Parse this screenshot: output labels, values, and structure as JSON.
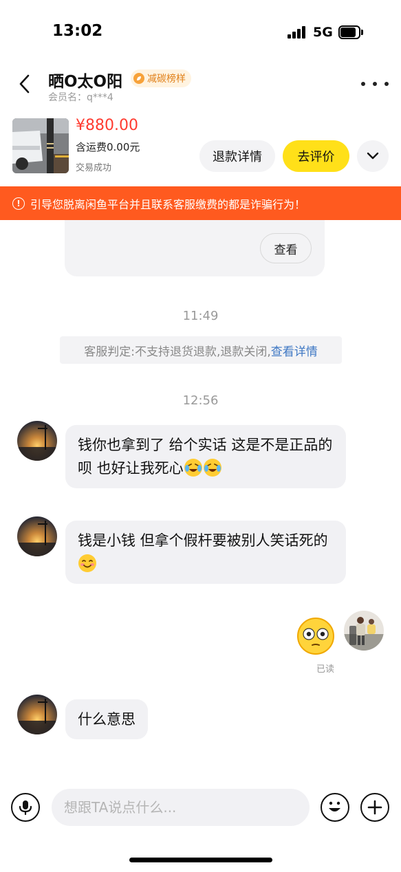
{
  "status_bar": {
    "time": "13:02",
    "network": "5G",
    "icons": [
      "signal-icon",
      "battery-icon"
    ]
  },
  "header": {
    "contact_name": "晒O太O阳",
    "badge_label": "减碳榜样",
    "member_label": "会员名：",
    "member_id": "q***4",
    "icons": [
      "back-arrow-icon",
      "more-dots-icon"
    ]
  },
  "product": {
    "price": "¥880.00",
    "shipping": "含运费0.00元",
    "status": "交易成功",
    "refund_label": "退款详情",
    "review_label": "去评价",
    "icons": [
      "chevron-down-icon"
    ]
  },
  "warning": {
    "text": "引导您脱离闲鱼平台并且联系客服缴费的都是诈骗行为！",
    "icon": "warning-circle-icon"
  },
  "chat": {
    "card_view_label": "查看",
    "timestamp_1": "11:49",
    "system_note_text": "客服判定:不支持退货退款,退款关闭,",
    "system_note_link": "查看详情",
    "timestamp_2": "12:56",
    "messages": [
      {
        "sender": "contact",
        "text": "钱你也拿到了 给个实话 这是不是正品的呗 也好让我死心",
        "emojis": [
          "crying-laughing-emoji",
          "crying-laughing-emoji"
        ]
      },
      {
        "sender": "contact",
        "text": "钱是小钱 但拿个假杆要被别人笑话死的",
        "emojis": [
          "smiling-emoji"
        ]
      },
      {
        "sender": "me",
        "sticker": "flushed-face-sticker",
        "read_status": "已读"
      },
      {
        "sender": "contact",
        "text": "什么意思"
      }
    ]
  },
  "input_bar": {
    "placeholder": "想跟TA说点什么...",
    "icons": [
      "microphone-icon",
      "emoji-icon",
      "plus-icon"
    ]
  },
  "colors": {
    "price_red": "#ff3b30",
    "warning_orange": "#ff5a1f",
    "review_yellow": "#ffe019",
    "link_blue": "#3f78c4",
    "bubble_gray": "#f1f1f4"
  }
}
